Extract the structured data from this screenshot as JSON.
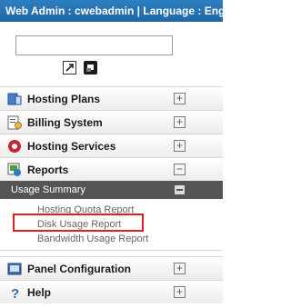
{
  "header": {
    "title": "Web Admin : cwebadmin | Language : English"
  },
  "search": {
    "value": ""
  },
  "menu": {
    "hosting_plans": "Hosting Plans",
    "billing_system": "Billing System",
    "hosting_services": "Hosting Services",
    "reports": "Reports",
    "panel_configuration": "Panel Configuration",
    "help": "Help"
  },
  "reports": {
    "group": "Usage Summary",
    "items": [
      "Hosting Quota Report",
      "Disk Usage Report",
      "Bandwidth Usage Report"
    ],
    "highlighted": "Disk Usage Report"
  },
  "toggles": {
    "plus": "+",
    "minus": "−"
  }
}
